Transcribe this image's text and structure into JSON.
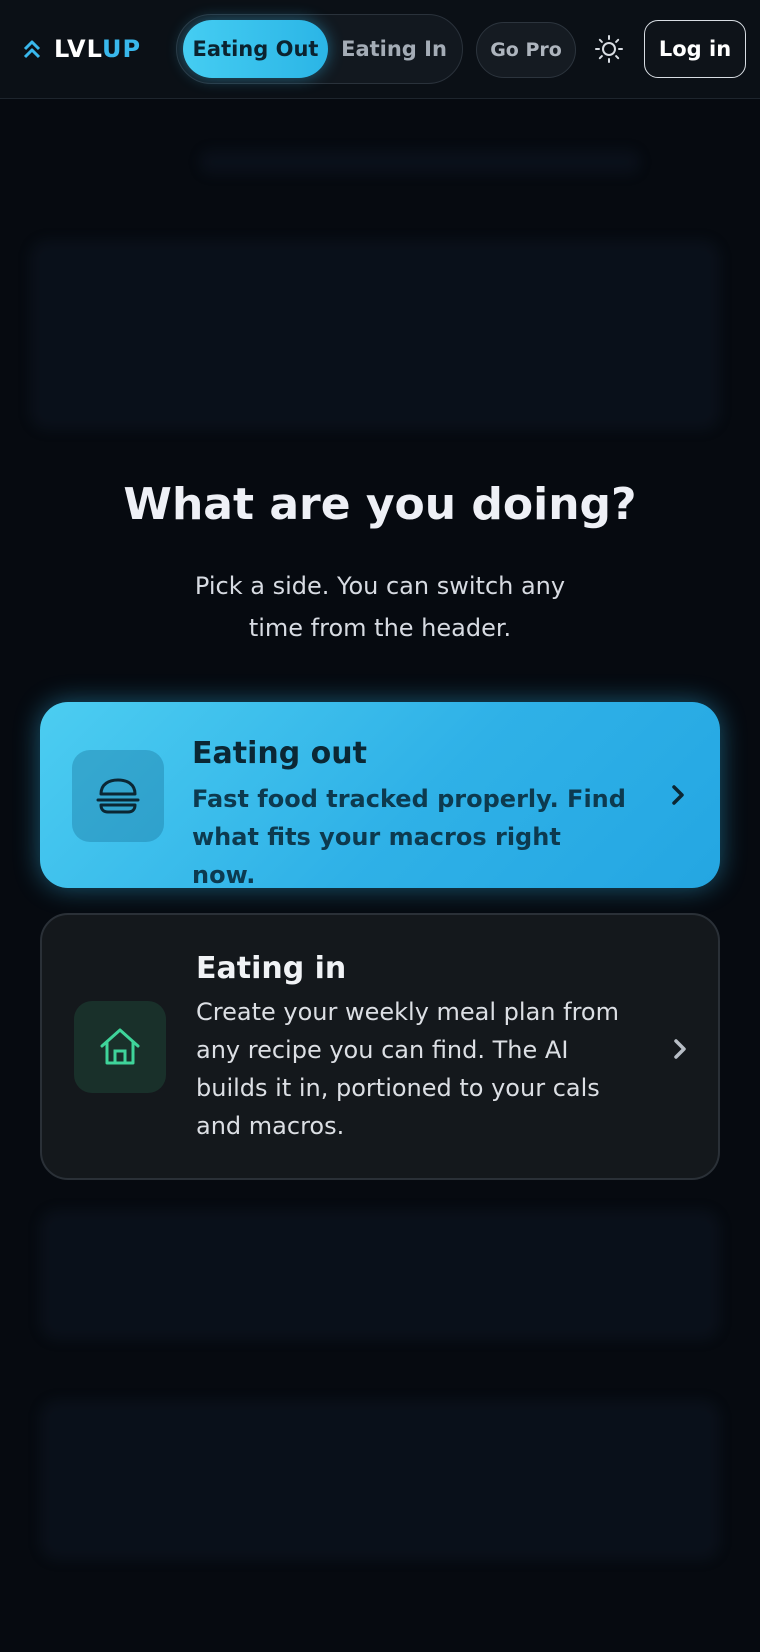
{
  "brand": {
    "logo_text_part1": "LVL",
    "logo_text_part2": "UP",
    "accent_color": "#39b8ec"
  },
  "header": {
    "mode_tabs": [
      {
        "label": "Eating Out",
        "active": true
      },
      {
        "label": "Eating In",
        "active": false
      }
    ],
    "go_pro_label": "Go Pro",
    "theme_toggle_icon": "sun-icon",
    "login_label": "Log in"
  },
  "main": {
    "title": "What are you doing?",
    "subtitle": "Pick a side. You can switch any time from the header.",
    "cards": [
      {
        "title": "Eating out",
        "description": "Fast food tracked properly. Find what fits your macros right now.",
        "icon": "burger-icon",
        "color": "#36bdeb"
      },
      {
        "title": "Eating in",
        "description": "Create your weekly meal plan from any recipe you can find. The AI builds it in, portioned to your cals and macros.",
        "icon": "home-icon",
        "color": "#3fd49a"
      }
    ]
  }
}
